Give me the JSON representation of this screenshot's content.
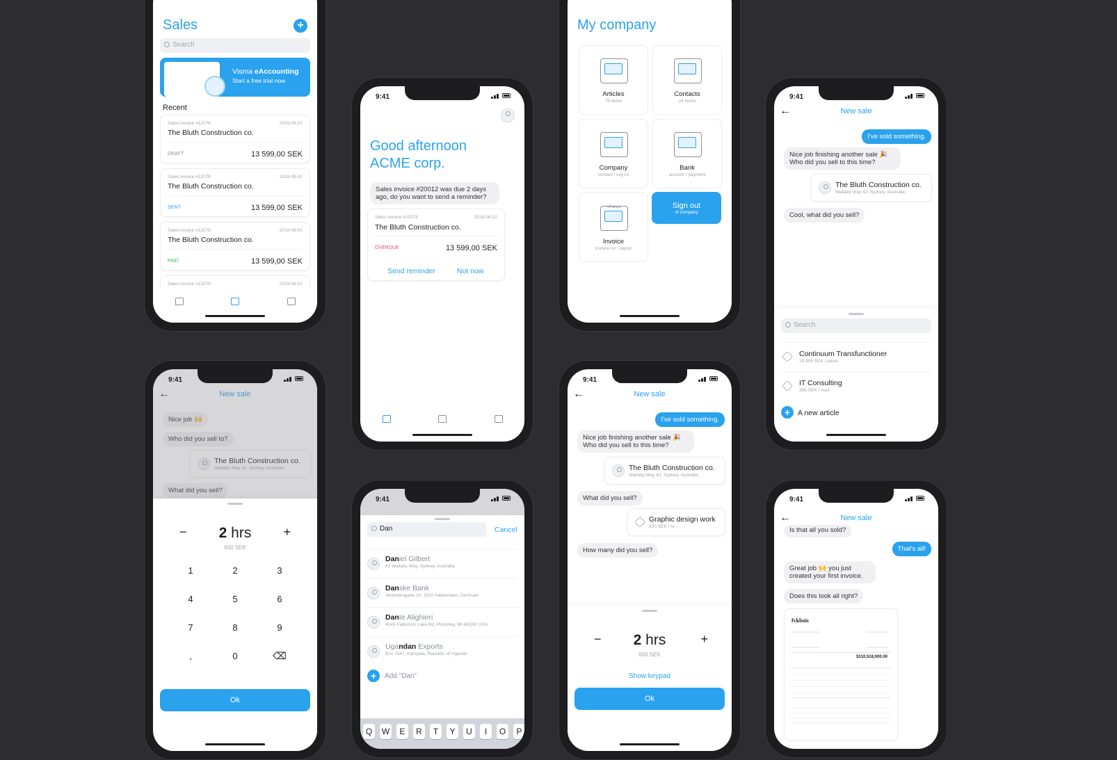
{
  "colors": {
    "accent": "#2aa2ee",
    "background": "#2d2d2f",
    "overdue": "#e5487a",
    "paid": "#3bbf5c",
    "sent": "#2aa2ee",
    "draft": "#8a8e96"
  },
  "status_time": "9:41",
  "sales": {
    "title": "Sales",
    "search": "Search",
    "banner": {
      "brand": "Visma",
      "product": "eAccounting",
      "subtitle": "Start a free trial now"
    },
    "recent": "Recent",
    "invoices": [
      {
        "number": "Sales invoice #12078",
        "date": "2018-08-02",
        "customer": "The Bluth Construction co.",
        "status": "DRAFT",
        "amount": "13 599,00 SEK"
      },
      {
        "number": "Sales invoice #12078",
        "date": "2018-08-02",
        "customer": "The Bluth Construction co.",
        "status": "SENT",
        "amount": "13 599,00 SEK"
      },
      {
        "number": "Sales invoice #12078",
        "date": "2018-08-02",
        "customer": "The Bluth Construction co.",
        "status": "PAID",
        "amount": "13 599,00 SEK"
      },
      {
        "number": "Sales invoice #12078",
        "date": "2018-08-02",
        "customer": "The Bluth Construction co."
      }
    ]
  },
  "home": {
    "greeting_line1": "Good afternoon",
    "greeting_line2": "ACME corp.",
    "bubble": "Sales invoice #20012 was due 2 days ago, do you want to send a reminder?",
    "card": {
      "number": "Sales invoice #12078",
      "date": "2018-08-02",
      "customer": "The Bluth Construction co.",
      "status": "OVERDUE",
      "amount": "13 599,00 SEK",
      "send": "Send reminder",
      "not_now": "Not now"
    }
  },
  "company": {
    "title": "My company",
    "tiles": [
      {
        "label": "Articles",
        "sub": "78 items"
      },
      {
        "label": "Contacts",
        "sub": "24 items"
      },
      {
        "label": "Company",
        "sub": "contact / org no"
      },
      {
        "label": "Bank",
        "sub": "account / payment"
      },
      {
        "label": "Invoice",
        "sub": "invoice no / layout",
        "art": "eFaktura"
      }
    ],
    "signout": "Sign out",
    "signout_sub": "of company"
  },
  "new_sale": {
    "title": "New sale",
    "sold": "I've sold something.",
    "nice": "Nice job finishing another sale 🎉",
    "who": "Who did you sell to this time?",
    "customer": "The Bluth Construction co.",
    "address": "Wallaby Way 42, Sydney, Australia",
    "what": "Cool, what did you sell?",
    "search": "Search",
    "articles": [
      {
        "name": "Continuum Transfunctioner",
        "price": "19 999 SEK / piece"
      },
      {
        "name": "IT Consulting",
        "price": "399 SEK / hour"
      }
    ],
    "new_article": "A new article"
  },
  "keypad": {
    "nice": "Nice job 🙌",
    "who": "Who did you sell to?",
    "what": "What did you sell?",
    "value": "2",
    "unit": "hrs",
    "sek": "600 SEK",
    "keys": [
      "1",
      "2",
      "3",
      "4",
      "5",
      "6",
      "7",
      "8",
      "9",
      ",",
      "0"
    ],
    "ok": "Ok"
  },
  "contacts": {
    "query": "Dan",
    "cancel": "Cancel",
    "results": [
      {
        "match": "Dan",
        "rest": "iel Gilbert",
        "addr": "42 Wallaby Way, Sydney, Australia"
      },
      {
        "match": "Dan",
        "rest": "ske Bank",
        "addr": "Vesterbrogade 10, 1620 København, Denmark"
      },
      {
        "match": "Dan",
        "rest": "te Alighieri",
        "addr": "4045 Patterson Lake Rd, Pinckney, MI 48169, USA"
      },
      {
        "pre": "Uga",
        "match": "ndan",
        "rest": " Exports",
        "addr": "Box 7047, Kampala, Republic of Uganda"
      }
    ],
    "add": "Add \"Dan\"",
    "kb": [
      "Q",
      "W",
      "E",
      "R",
      "T",
      "Y",
      "U",
      "I",
      "O",
      "P"
    ]
  },
  "hours": {
    "what": "What did you sell?",
    "article": "Graphic design work",
    "price": "300 SEK / hr",
    "how_many": "How many did you sell?",
    "show_keypad": "Show keypad"
  },
  "done": {
    "is_all": "Is that all you sold?",
    "thats_all": "That's all!",
    "great": "Great job 🙌 you just created your first invoice.",
    "look": "Does this look all right?",
    "doc_brand": "fvkbois",
    "doc_total": "$110,518,000.00"
  }
}
